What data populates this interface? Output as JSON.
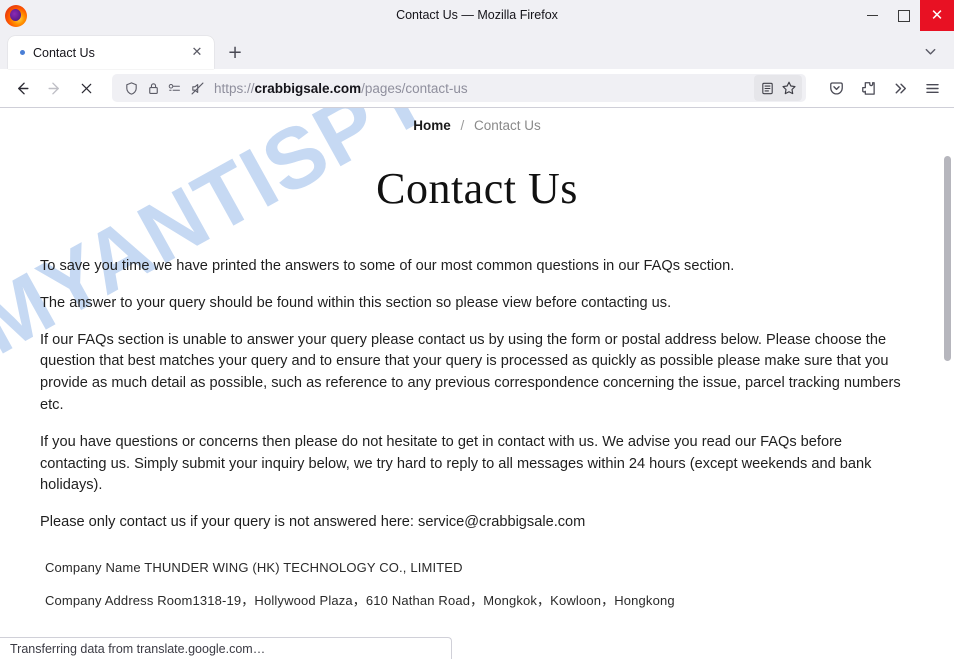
{
  "window": {
    "title": "Contact Us — Mozilla Firefox",
    "app_logo": "firefox-logo",
    "minimize_label": "Minimize",
    "maximize_label": "Maximize",
    "close_label": "Close",
    "close_color": "#e81123"
  },
  "tabbar": {
    "tabs": [
      {
        "title": "Contact Us",
        "close_label": "Close tab",
        "loading": true
      }
    ],
    "new_tab_label": "+",
    "list_all_tabs_label": "List all tabs"
  },
  "toolbar": {
    "back_label": "Go back one page",
    "forward_label": "Go forward one page",
    "stop_label": "Stop loading this page",
    "reader_label": "Toggle reader view",
    "bookmark_label": "Bookmark this page",
    "pocket_label": "Save to Pocket",
    "extensions_label": "Extensions",
    "overflow_label": "More tools",
    "menu_label": "Open application menu"
  },
  "urlbar": {
    "scheme": "https://",
    "host": "crabbigsale.com",
    "path": "/pages/contact-us",
    "full_url": "https://crabbigsale.com/pages/contact-us",
    "shield_label": "tracking-protection-shield",
    "lock_label": "connection-secure-lock",
    "permissions_label": "site-permissions",
    "autoplay_blocked_label": "autoplay-blocked"
  },
  "page": {
    "watermark": "MYANTISPYWARE.COM",
    "watermark_color": "#c6d9f3",
    "breadcrumb": {
      "home": "Home",
      "separator": "/",
      "current": "Contact Us"
    },
    "title": "Contact Us",
    "paragraphs": [
      "To save you time we have printed the answers to some of our most common questions in our FAQs section.",
      "The answer to your query should be found within this section so please view before contacting us.",
      "If our FAQs section is unable to answer your query please contact us by using the form or postal address below. Please choose the question that best matches your query and to ensure that your query is processed as quickly as possible please make sure that you provide as much detail as possible, such as reference to any previous correspondence concerning the issue, parcel tracking numbers etc.",
      "If you have questions or concerns then please do not hesitate to get in contact with us. We advise you read our FAQs before contacting us. Simply submit your inquiry below, we try hard to reply to all messages within 24 hours (except weekends and bank holidays).",
      "Please only contact us if your query is not answered here: service@crabbigsale.com"
    ],
    "company": [
      "Company Name THUNDER WING (HK) TECHNOLOGY CO., LIMITED",
      "Company Address Room1318-19，Hollywood Plaza，610 Nathan Road，Mongkok，Kowloon，Hongkong"
    ]
  },
  "statusbar": {
    "text": "Transferring data from translate.google.com…"
  },
  "scrollbar": {
    "vertical_label": "Vertical scrollbar"
  }
}
